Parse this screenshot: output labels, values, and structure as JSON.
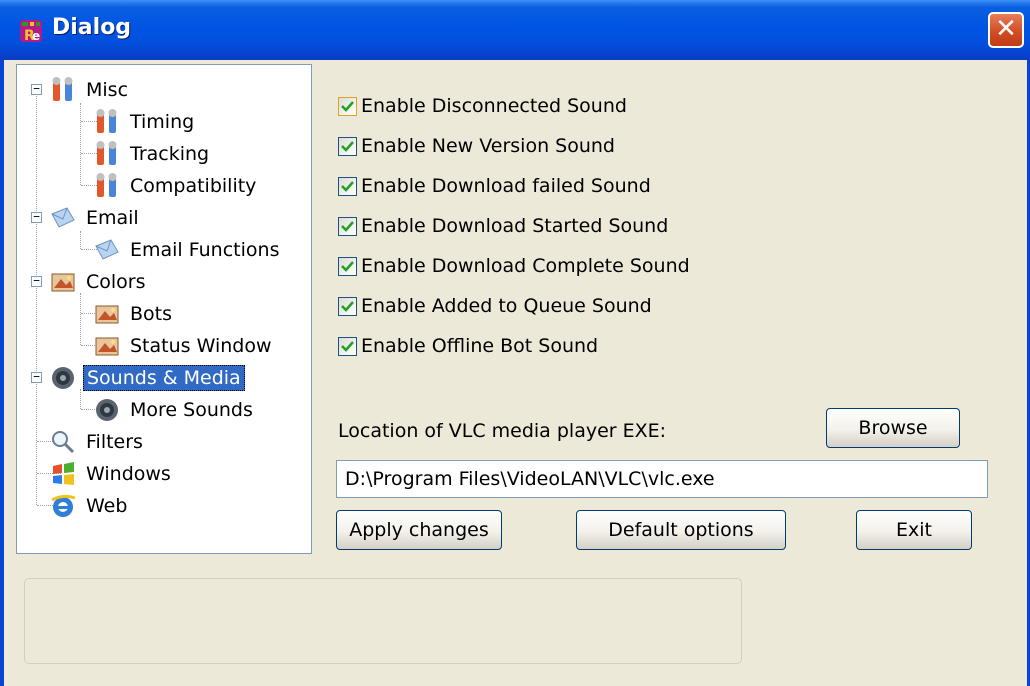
{
  "window": {
    "title": "Dialog",
    "close_glyph": "✕"
  },
  "tree": {
    "items": [
      {
        "label": "Misc",
        "icon": "tools-icon"
      },
      {
        "label": "Timing",
        "icon": "tools-icon"
      },
      {
        "label": "Tracking",
        "icon": "tools-icon"
      },
      {
        "label": "Compatibility",
        "icon": "tools-icon"
      },
      {
        "label": "Email",
        "icon": "email-icon"
      },
      {
        "label": "Email Functions",
        "icon": "email-icon"
      },
      {
        "label": "Colors",
        "icon": "palette-icon"
      },
      {
        "label": "Bots",
        "icon": "palette-icon"
      },
      {
        "label": "Status Window",
        "icon": "palette-icon"
      },
      {
        "label": "Sounds & Media",
        "icon": "speaker-icon",
        "selected": true
      },
      {
        "label": "More Sounds",
        "icon": "speaker-icon"
      },
      {
        "label": "Filters",
        "icon": "magnifier-icon"
      },
      {
        "label": "Windows",
        "icon": "windows-flag-icon"
      },
      {
        "label": "Web",
        "icon": "internet-explorer-icon"
      }
    ]
  },
  "sounds": {
    "options": [
      {
        "label": "Enable Disconnected Sound",
        "checked": true
      },
      {
        "label": "Enable New Version Sound",
        "checked": true
      },
      {
        "label": "Enable Download failed Sound",
        "checked": true
      },
      {
        "label": "Enable Download Started Sound",
        "checked": true
      },
      {
        "label": "Enable Download Complete Sound",
        "checked": true
      },
      {
        "label": "Enable Added to Queue Sound",
        "checked": true
      },
      {
        "label": "Enable Offline Bot Sound",
        "checked": true
      }
    ],
    "vlc_label": "Location of VLC media player EXE:",
    "browse_label": "Browse",
    "vlc_path": "D:\\Program Files\\VideoLAN\\VLC\\vlc.exe"
  },
  "buttons": {
    "apply": "Apply changes",
    "default": "Default options",
    "exit": "Exit"
  },
  "status": {
    "text": ""
  },
  "colors": {
    "titlebar": "#0054e3",
    "selection": "#316ac5",
    "checkmark": "#21a121",
    "close_button": "#d04a22",
    "dialog_face": "#ece9d8"
  }
}
